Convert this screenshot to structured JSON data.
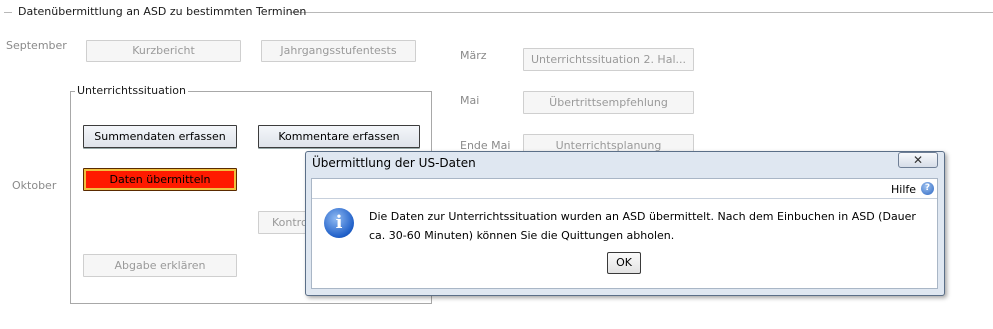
{
  "group": {
    "title": "Datenübermittlung an ASD zu bestimmten Terminen",
    "months": {
      "september": "September",
      "oktober": "Oktober",
      "maerz": "März",
      "mai": "Mai",
      "ende_mai": "Ende Mai"
    },
    "buttons": {
      "kurzbericht": "Kurzbericht",
      "jahrgangsstufentests": "Jahrgangsstufentests",
      "unterrichtssituation_2": "Unterrichtssituation 2. Hal...",
      "uebertrittsempfehlung": "Übertrittsempfehlung",
      "unterrichtsplanung": "Unterrichtsplanung"
    }
  },
  "unterrichtssituation": {
    "title": "Unterrichtssituation",
    "summendaten": "Summendaten erfassen",
    "kommentare": "Kommentare erfassen",
    "daten_uebermitteln": "Daten übermitteln",
    "kontrolle_partial": "Kontro",
    "abgabe_erklaeren": "Abgabe erklären"
  },
  "dialog": {
    "title": "Übermittlung der US-Daten",
    "close_glyph": "✕",
    "help_label": "Hilfe",
    "help_glyph": "?",
    "info_glyph": "i",
    "message": "Die Daten zur Unterrichtssituation wurden an ASD übermittelt. Nach dem Einbuchen in ASD (Dauer ca. 30-60 Minuten) können Sie die Quittungen abholen.",
    "ok_label": "OK"
  }
}
